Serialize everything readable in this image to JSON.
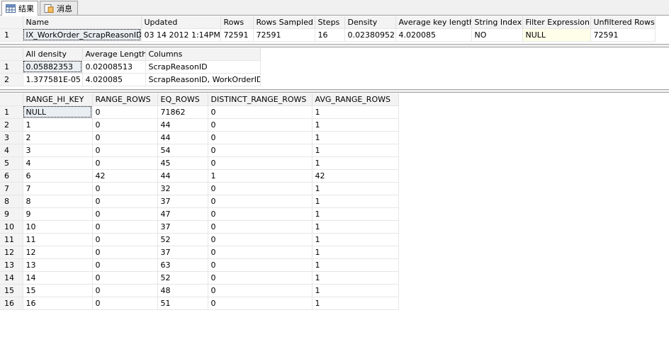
{
  "tabs": [
    {
      "label": "结果",
      "icon": "grid-icon"
    },
    {
      "label": "消息",
      "icon": "messages-icon"
    }
  ],
  "grids": [
    {
      "name": "stats-header-grid",
      "columns": [
        "Name",
        "Updated",
        "Rows",
        "Rows Sampled",
        "Steps",
        "Density",
        "Average key length",
        "String Index",
        "Filter Expression",
        "Unfiltered Rows"
      ],
      "rows": [
        [
          "IX_WorkOrder_ScrapReasonID",
          "03 14 2012  1:14PM",
          "72591",
          "72591",
          "16",
          "0.02380952",
          "4.020085",
          "NO",
          "NULL",
          "72591"
        ]
      ]
    },
    {
      "name": "density-vector-grid",
      "columns": [
        "All density",
        "Average Length",
        "Columns"
      ],
      "rows": [
        [
          "0.05882353",
          "0.02008513",
          "ScrapReasonID"
        ],
        [
          "1.377581E-05",
          "4.020085",
          "ScrapReasonID, WorkOrderID"
        ]
      ]
    },
    {
      "name": "histogram-grid",
      "columns": [
        "RANGE_HI_KEY",
        "RANGE_ROWS",
        "EQ_ROWS",
        "DISTINCT_RANGE_ROWS",
        "AVG_RANGE_ROWS"
      ],
      "rows": [
        [
          "NULL",
          "0",
          "71862",
          "0",
          "1"
        ],
        [
          "1",
          "0",
          "44",
          "0",
          "1"
        ],
        [
          "2",
          "0",
          "44",
          "0",
          "1"
        ],
        [
          "3",
          "0",
          "54",
          "0",
          "1"
        ],
        [
          "4",
          "0",
          "45",
          "0",
          "1"
        ],
        [
          "6",
          "42",
          "44",
          "1",
          "42"
        ],
        [
          "7",
          "0",
          "32",
          "0",
          "1"
        ],
        [
          "8",
          "0",
          "37",
          "0",
          "1"
        ],
        [
          "9",
          "0",
          "47",
          "0",
          "1"
        ],
        [
          "10",
          "0",
          "37",
          "0",
          "1"
        ],
        [
          "11",
          "0",
          "52",
          "0",
          "1"
        ],
        [
          "12",
          "0",
          "37",
          "0",
          "1"
        ],
        [
          "13",
          "0",
          "63",
          "0",
          "1"
        ],
        [
          "14",
          "0",
          "52",
          "0",
          "1"
        ],
        [
          "15",
          "0",
          "48",
          "0",
          "1"
        ],
        [
          "16",
          "0",
          "51",
          "0",
          "1"
        ]
      ]
    }
  ]
}
